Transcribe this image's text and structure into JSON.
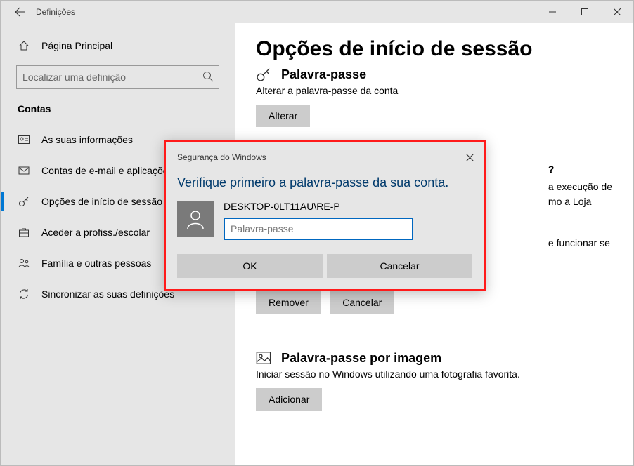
{
  "titlebar": {
    "title": "Definições"
  },
  "sidebar": {
    "home": "Página Principal",
    "search_placeholder": "Localizar uma definição",
    "category": "Contas",
    "items": [
      {
        "label": "As suas informações"
      },
      {
        "label": "Contas de e-mail e aplicações"
      },
      {
        "label": "Opções de início de sessão"
      },
      {
        "label": "Aceder a profiss./escolar"
      },
      {
        "label": "Família e outras pessoas"
      },
      {
        "label": "Sincronizar as suas definições"
      }
    ]
  },
  "main": {
    "heading": "Opções de início de sessão",
    "pw_section_truncated": "Palavra-passe",
    "pw_subtext": "Alterar a palavra-passe da conta",
    "pw_button": "Alterar",
    "hidden_text1": "a execução de",
    "hidden_text2": "mo a Loja",
    "hidden_text3": "e funcionar se",
    "remove_btn": "Remover",
    "cancel_btn": "Cancelar",
    "photo_section": "Palavra-passe por imagem",
    "photo_subtext": "Iniciar sessão no Windows utilizando uma fotografia favorita.",
    "photo_button": "Adicionar",
    "question_mark": "?"
  },
  "dialog": {
    "title": "Segurança do Windows",
    "heading": "Verifique primeiro a palavra-passe da sua conta.",
    "user": "DESKTOP-0LT11AU\\RE-P",
    "pw_placeholder": "Palavra-passe",
    "ok": "OK",
    "cancel": "Cancelar"
  }
}
